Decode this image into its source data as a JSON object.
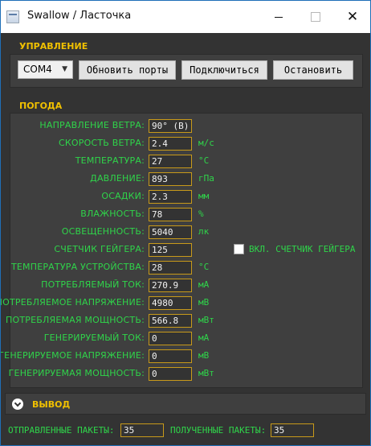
{
  "window": {
    "title": "Swallow / Ласточка",
    "minimize": "—",
    "maximize": "☐",
    "close": "✕"
  },
  "control": {
    "section_label": "УПРАВЛЕНИЕ",
    "port_value": "COM4",
    "refresh_label": "Обновить порты",
    "connect_label": "Подключиться",
    "stop_label": "Остановить"
  },
  "weather": {
    "section_label": "ПОГОДА",
    "rows": [
      {
        "label": "НАПРАВЛЕНИЕ ВЕТРА:",
        "value": "90° (В)",
        "unit": ""
      },
      {
        "label": "СКОРОСТЬ ВЕТРА:",
        "value": "2.4",
        "unit": "м/с"
      },
      {
        "label": "ТЕМПЕРАТУРА:",
        "value": "27",
        "unit": "°С"
      },
      {
        "label": "ДАВЛЕНИЕ:",
        "value": "893",
        "unit": "гПа"
      },
      {
        "label": "ОСАДКИ:",
        "value": "2.3",
        "unit": "мм"
      },
      {
        "label": "ВЛАЖНОСТЬ:",
        "value": "78",
        "unit": "%"
      },
      {
        "label": "ОСВЕЩЕННОСТЬ:",
        "value": "5040",
        "unit": "лк"
      },
      {
        "label": "СЧЕТЧИК ГЕЙГЕРА:",
        "value": "125",
        "unit": ""
      },
      {
        "label": "ТЕМПЕРАТУРА УСТРОЙСТВА:",
        "value": "28",
        "unit": "°С"
      },
      {
        "label": "ПОТРЕБЛЯЕМЫЙ ТОК:",
        "value": "270.9",
        "unit": "мА"
      },
      {
        "label": "ПОТРЕБЛЯЕМОЕ НАПРЯЖЕНИЕ:",
        "value": "4980",
        "unit": "мВ"
      },
      {
        "label": "ПОТРЕБЛЯЕМАЯ МОЩНОСТЬ:",
        "value": "566.8",
        "unit": "мВт"
      },
      {
        "label": "ГЕНЕРИРУЕМЫЙ ТОК:",
        "value": "0",
        "unit": "мА"
      },
      {
        "label": "ГЕНЕРИРУЕМОЕ НАПРЯЖЕНИЕ:",
        "value": "0",
        "unit": "мВ"
      },
      {
        "label": "ГЕНЕРИРУЕМАЯ МОЩНОСТЬ:",
        "value": "0",
        "unit": "мВт"
      }
    ],
    "geiger_toggle_label": "ВКЛ. СЧЕТЧИК ГЕЙГЕРА"
  },
  "output": {
    "section_label": "ВЫВОД"
  },
  "status": {
    "sent_label": "ОТПРАВЛЕННЫЕ ПАКЕТЫ:",
    "sent_value": "35",
    "received_label": "ПОЛУЧЕННЫЕ ПАКЕТЫ:",
    "received_value": "35"
  },
  "colors": {
    "accent": "#f0c000",
    "text_green": "#2fd44a",
    "field_border": "#c89a1a",
    "background": "#333333"
  }
}
